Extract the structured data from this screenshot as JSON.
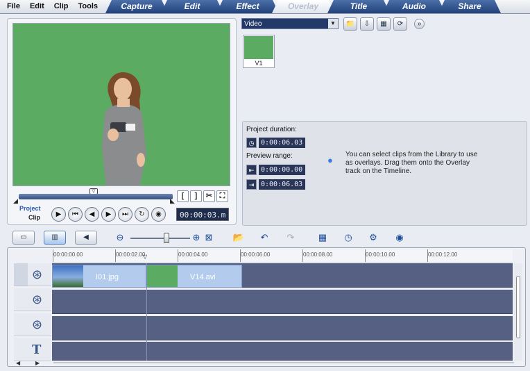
{
  "menu": [
    "File",
    "Edit",
    "Clip",
    "Tools"
  ],
  "tabs": [
    {
      "label": "Capture",
      "active": false
    },
    {
      "label": "Edit",
      "active": false
    },
    {
      "label": "Effect",
      "active": false
    },
    {
      "label": "Overlay",
      "active": true
    },
    {
      "label": "Title",
      "active": false
    },
    {
      "label": "Audio",
      "active": false
    },
    {
      "label": "Share",
      "active": false
    }
  ],
  "preview": {
    "mode_project": "Project",
    "mode_clip": "Clip",
    "timecode": "00:00:03.m",
    "mark_in": "[",
    "mark_out": "]"
  },
  "library": {
    "category": "Video",
    "clips": [
      {
        "name": "V1"
      }
    ]
  },
  "info": {
    "project_duration_label": "Project duration:",
    "project_duration": "0:00:06.03",
    "preview_range_label": "Preview range:",
    "range_start": "0:00:00.00",
    "range_end": "0:00:06.03",
    "hint": "You can select clips from the Library to use as overlays. Drag them onto the Overlay track on the Timeline."
  },
  "timeline": {
    "ruler_ticks": [
      "00:00:00.00",
      "00:00:02.00",
      "00:00:04.00",
      "00:00:06.00",
      "00:00:08.00",
      "00:00:10.00",
      "00:00:12.00"
    ],
    "clips": [
      {
        "name": "I01.jpg"
      },
      {
        "name": "V14.avi"
      }
    ]
  },
  "colors": {
    "accent": "#22427a",
    "track": "#566083",
    "clip": "#b3cbec",
    "screen": "#5cab63"
  }
}
